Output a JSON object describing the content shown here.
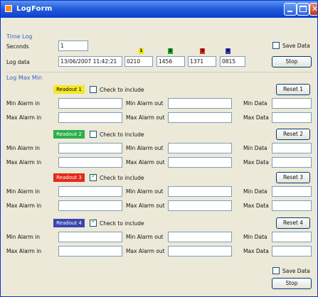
{
  "window": {
    "title": "LogForm"
  },
  "timelog": {
    "section_title": "Time Log",
    "seconds_label": "Seconds",
    "seconds_value": "1",
    "logdata_label": "Log data",
    "logdata_value": "13/06/2007 11:42:21",
    "values": [
      "0210",
      "1456",
      "1371",
      "0815"
    ],
    "markers": [
      {
        "num": "1",
        "color": "#f0e800"
      },
      {
        "num": "2",
        "color": "#22a22a"
      },
      {
        "num": "3",
        "color": "#e02a1c"
      },
      {
        "num": "4",
        "color": "#3a3ab8"
      }
    ],
    "save_label": "Save Data",
    "save_checked": false,
    "stop_label": "Stop"
  },
  "logmax": {
    "section_title": "Log Max Min",
    "readouts": [
      {
        "label": "Readout 1",
        "color": "#f5e826",
        "text_color": "#000",
        "checked": false,
        "include_label": "Check to include",
        "reset_label": "Reset 1"
      },
      {
        "label": "Readout 2",
        "color": "#2bb04b",
        "text_color": "#fff",
        "checked": false,
        "include_label": "Check to include",
        "reset_label": "Reset 2"
      },
      {
        "label": "Readout 3",
        "color": "#e22b1c",
        "text_color": "#fff",
        "checked": true,
        "include_label": "Check to include",
        "reset_label": "Reset 3"
      },
      {
        "label": "Readout 4",
        "color": "#3a46b0",
        "text_color": "#fff",
        "checked": true,
        "include_label": "Check to include",
        "reset_label": "Reset 4"
      }
    ],
    "row_labels": {
      "min_in": "Min Alarm in",
      "min_out": "Min Alarm out",
      "min_data": "Min Data",
      "max_in": "Max Alarm in",
      "max_out": "Max Alarm out",
      "max_data": "Max Data"
    }
  },
  "footer": {
    "save_label": "Save Data",
    "save_checked": false,
    "stop_label": "Stop"
  }
}
